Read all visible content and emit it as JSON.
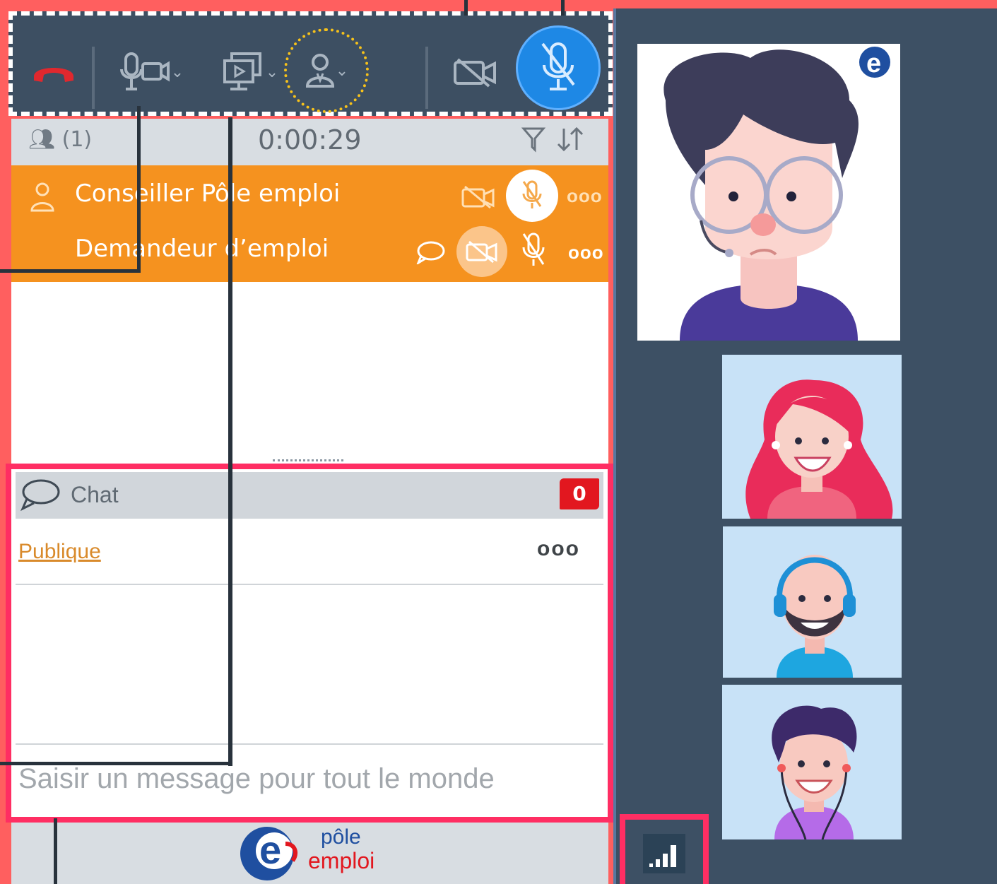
{
  "toolbar": {
    "buttons": [
      {
        "name": "hang-up-button",
        "icon": "phone-hangup-icon"
      },
      {
        "name": "mic-camera-settings-button",
        "icon": "mic-camera-icon"
      },
      {
        "name": "screen-share-button",
        "icon": "screen-share-icon"
      },
      {
        "name": "presenter-role-button",
        "icon": "user-icon"
      },
      {
        "name": "camera-toggle-button",
        "icon": "video-off-icon"
      },
      {
        "name": "mic-toggle-button",
        "icon": "mic-off-icon"
      }
    ],
    "colors": {
      "background": "#3d4f62",
      "hangup": "#e0282e",
      "mic_active": "#1e88e5",
      "highlight": "#f7c21a"
    }
  },
  "participants": {
    "count": "(1)",
    "timer": "0:00:29",
    "list": [
      {
        "name": "Conseiller Pôle emploi",
        "role": "host"
      },
      {
        "name": "Demandeur d’emploi",
        "role": "guest"
      }
    ],
    "colors": {
      "row": "#f5921f"
    }
  },
  "chat": {
    "title": "Chat",
    "unread": "0",
    "channel": "Publique",
    "more": "ooo",
    "input_placeholder": "Saisir un message pour tout le monde"
  },
  "footer": {
    "logo_line1": "pôle",
    "logo_line2": "emploi"
  },
  "video": {
    "tiles": [
      "advisor-avatar",
      "woman-avatar",
      "bald-man-avatar",
      "young-man-avatar"
    ],
    "signal_icon": "signal-strength-icon"
  }
}
